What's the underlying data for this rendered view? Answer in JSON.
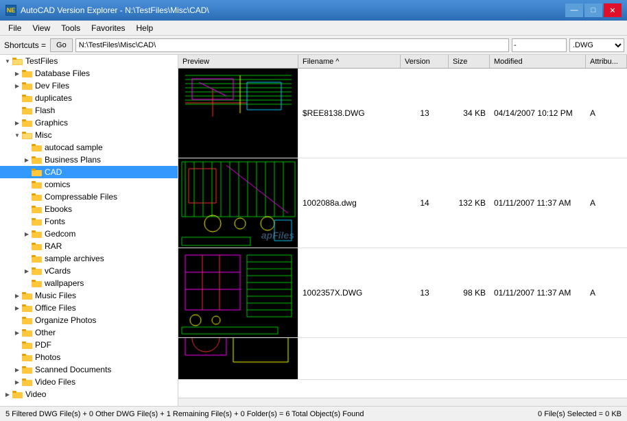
{
  "titleBar": {
    "icon": "NE",
    "title": "AutoCAD Version Explorer - N:\\TestFiles\\Misc\\CAD\\",
    "minimize": "—",
    "maximize": "□",
    "close": "✕"
  },
  "menuBar": {
    "items": [
      "File",
      "View",
      "Tools",
      "Favorites",
      "Help"
    ]
  },
  "toolbar": {
    "shortcutsLabel": "Shortcuts =",
    "goButton": "Go",
    "pathValue": "N:\\TestFiles\\Misc\\CAD\\",
    "filterValue": "-",
    "extValue": ".DWG"
  },
  "columnHeaders": {
    "preview": "Preview",
    "filename": "Filename ^",
    "version": "Version",
    "size": "Size",
    "modified": "Modified",
    "attr": "Attribu..."
  },
  "treeItems": [
    {
      "id": "testfiles",
      "label": "TestFiles",
      "indent": 0,
      "expanded": true,
      "arrow": "expanded"
    },
    {
      "id": "database-files",
      "label": "Database Files",
      "indent": 1,
      "arrow": "collapsed"
    },
    {
      "id": "dev-files",
      "label": "Dev Files",
      "indent": 1,
      "arrow": "collapsed"
    },
    {
      "id": "duplicates",
      "label": "duplicates",
      "indent": 1,
      "arrow": "leaf"
    },
    {
      "id": "flash",
      "label": "Flash",
      "indent": 1,
      "arrow": "leaf"
    },
    {
      "id": "graphics",
      "label": "Graphics",
      "indent": 1,
      "arrow": "collapsed"
    },
    {
      "id": "misc",
      "label": "Misc",
      "indent": 1,
      "arrow": "expanded",
      "expanded": true
    },
    {
      "id": "autocad-sample",
      "label": "autocad sample",
      "indent": 2,
      "arrow": "leaf"
    },
    {
      "id": "business-plans",
      "label": "Business Plans",
      "indent": 2,
      "arrow": "collapsed"
    },
    {
      "id": "cad",
      "label": "CAD",
      "indent": 2,
      "arrow": "leaf",
      "selected": true
    },
    {
      "id": "comics",
      "label": "comics",
      "indent": 2,
      "arrow": "leaf"
    },
    {
      "id": "compressable-files",
      "label": "Compressable Files",
      "indent": 2,
      "arrow": "leaf"
    },
    {
      "id": "ebooks",
      "label": "Ebooks",
      "indent": 2,
      "arrow": "leaf"
    },
    {
      "id": "fonts",
      "label": "Fonts",
      "indent": 2,
      "arrow": "leaf"
    },
    {
      "id": "gedcom",
      "label": "Gedcom",
      "indent": 2,
      "arrow": "collapsed"
    },
    {
      "id": "rar",
      "label": "RAR",
      "indent": 2,
      "arrow": "leaf"
    },
    {
      "id": "sample-archives",
      "label": "sample archives",
      "indent": 2,
      "arrow": "leaf"
    },
    {
      "id": "vcards",
      "label": "vCards",
      "indent": 2,
      "arrow": "collapsed"
    },
    {
      "id": "wallpapers",
      "label": "wallpapers",
      "indent": 2,
      "arrow": "leaf"
    },
    {
      "id": "music-files",
      "label": "Music Files",
      "indent": 1,
      "arrow": "collapsed"
    },
    {
      "id": "office-files",
      "label": "Office Files",
      "indent": 1,
      "arrow": "collapsed"
    },
    {
      "id": "organize-photos",
      "label": "Organize Photos",
      "indent": 1,
      "arrow": "leaf"
    },
    {
      "id": "other",
      "label": "Other",
      "indent": 1,
      "arrow": "collapsed"
    },
    {
      "id": "pdf",
      "label": "PDF",
      "indent": 1,
      "arrow": "leaf"
    },
    {
      "id": "photos",
      "label": "Photos",
      "indent": 1,
      "arrow": "leaf"
    },
    {
      "id": "scanned-documents",
      "label": "Scanned Documents",
      "indent": 1,
      "arrow": "collapsed"
    },
    {
      "id": "video-files",
      "label": "Video Files",
      "indent": 1,
      "arrow": "collapsed"
    },
    {
      "id": "video",
      "label": "Video",
      "indent": 0,
      "arrow": "collapsed"
    }
  ],
  "files": [
    {
      "filename": "$REE8138.DWG",
      "version": "13",
      "size": "34 KB",
      "modified": "04/14/2007 10:12 PM",
      "attr": "A"
    },
    {
      "filename": "1002088a.dwg",
      "version": "14",
      "size": "132 KB",
      "modified": "01/11/2007 11:37 AM",
      "attr": "A"
    },
    {
      "filename": "1002357X.DWG",
      "version": "13",
      "size": "98 KB",
      "modified": "01/11/2007 11:37 AM",
      "attr": "A"
    }
  ],
  "statusBar": {
    "left": "5 Filtered DWG File(s) + 0 Other DWG File(s) + 1 Remaining File(s) + 0 Folder(s)  =  6 Total Object(s) Found",
    "right": "0 File(s) Selected = 0 KB"
  }
}
